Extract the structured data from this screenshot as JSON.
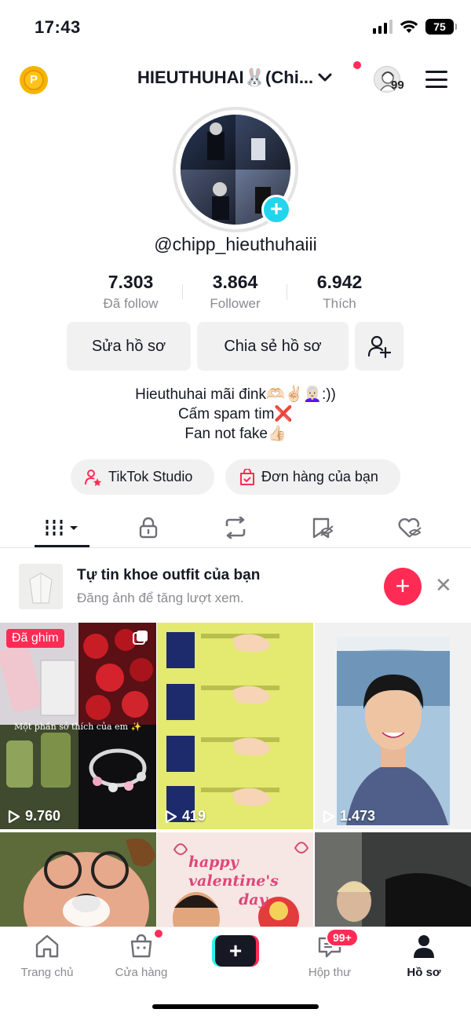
{
  "status_bar": {
    "time": "17:43",
    "battery": "75"
  },
  "header": {
    "username": "HIEUTHUHAI🐰(Chi...",
    "story_count": "99"
  },
  "profile": {
    "handle": "@chipp_hieuthuhaiii",
    "stats": [
      {
        "value": "7.303",
        "label": "Đã follow"
      },
      {
        "value": "3.864",
        "label": "Follower"
      },
      {
        "value": "6.942",
        "label": "Thích"
      }
    ],
    "edit_button": "Sửa hồ sơ",
    "share_button": "Chia sẻ hồ sơ",
    "bio": [
      "Hieuthuhai mãi đink🫶🏻✌🏻👩🏻‍🦳:))",
      "Cấm spam tim❌",
      "Fan not fake👍🏻"
    ],
    "pills": [
      "TikTok Studio",
      "Đơn hàng của bạn"
    ]
  },
  "promo": {
    "title": "Tự tin khoe outfit của bạn",
    "subtitle": "Đăng ảnh để tăng lượt xem."
  },
  "videos": [
    {
      "views": "9.760",
      "pinned_label": "Đã ghim",
      "caption": "Một phần sở thích của em ✨"
    },
    {
      "views": "419"
    },
    {
      "views": "1.473"
    }
  ],
  "valentine_text": [
    "happy valentine's",
    "day"
  ],
  "nav": {
    "items": [
      "Trang chủ",
      "Cửa hàng",
      "Hộp thư",
      "Hồ sơ"
    ],
    "inbox_badge": "99+"
  },
  "colors": {
    "accent": "#fe2c55",
    "cyan": "#25f4ee",
    "text": "#161823",
    "secondary": "#8a8b91"
  }
}
